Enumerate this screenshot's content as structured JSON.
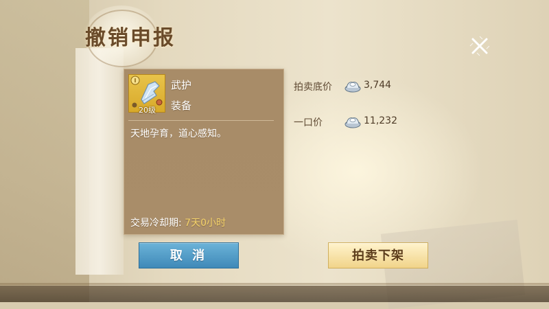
{
  "dialog": {
    "title": "撤销申报",
    "close_icon": "close-icon"
  },
  "item": {
    "name": "武护",
    "type": "装备",
    "level_text": "20级",
    "icon": "boot-equipment-icon",
    "description": "天地孕育，道心感知。",
    "cooldown_label": "交易冷却期:",
    "cooldown_value": "7天0小时"
  },
  "prices": [
    {
      "label": "拍卖底价",
      "icon": "silver-ingot-icon",
      "value": "3,744"
    },
    {
      "label": "一口价",
      "icon": "silver-ingot-icon",
      "value": "11,232"
    }
  ],
  "buttons": {
    "cancel_label": "取 消",
    "confirm_label": "拍卖下架"
  },
  "colors": {
    "cancel_button": "#4a97c4",
    "confirm_button": "#f4dc9c",
    "card_background": "#a88c68",
    "cooldown_value": "#f5d36a"
  }
}
